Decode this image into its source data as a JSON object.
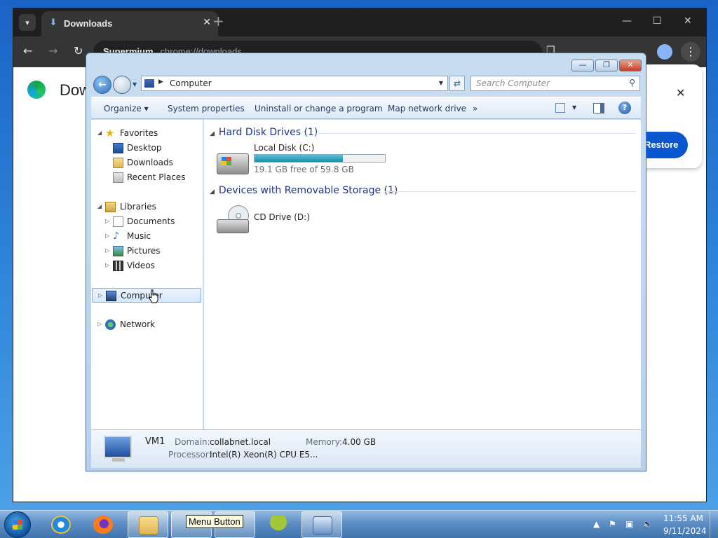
{
  "browser": {
    "tab_title": "Downloads",
    "url_prefix": "Supermium",
    "url": "chrome://downloads",
    "page_heading_partial": "Dow",
    "restore_button": "Restore"
  },
  "explorer": {
    "address": {
      "location": "Computer"
    },
    "search": {
      "placeholder": "Search Computer"
    },
    "toolbar": {
      "organize": "Organize",
      "system_properties": "System properties",
      "uninstall": "Uninstall or change a program",
      "map_network_drive": "Map network drive",
      "more": "»"
    },
    "nav": {
      "favorites": "Favorites",
      "desktop": "Desktop",
      "downloads": "Downloads",
      "recent_places": "Recent Places",
      "libraries": "Libraries",
      "documents": "Documents",
      "music": "Music",
      "pictures": "Pictures",
      "videos": "Videos",
      "computer": "Computer",
      "network": "Network"
    },
    "groups": {
      "hard_disks": "Hard Disk Drives (1)",
      "removable": "Devices with Removable Storage (1)"
    },
    "drives": {
      "c_name": "Local Disk (C:)",
      "c_free": "19.1 GB free of 59.8 GB",
      "c_used_fraction": 0.68,
      "d_name": "CD Drive (D:)"
    },
    "details": {
      "name": "VM1",
      "domain_label": "Domain:",
      "domain_value": "collabnet.local",
      "memory_label": "Memory:",
      "memory_value": "4.00 GB",
      "processor_label": "Processor:",
      "processor_value": "Intel(R) Xeon(R) CPU E5..."
    }
  },
  "taskbar": {
    "tooltip": "Menu Button",
    "time": "11:55 AM",
    "date": "9/11/2024"
  },
  "colors": {
    "group_heading": "#1e3287",
    "selection_border": "#84acdd",
    "usage_fill": "#1a8ea6"
  }
}
